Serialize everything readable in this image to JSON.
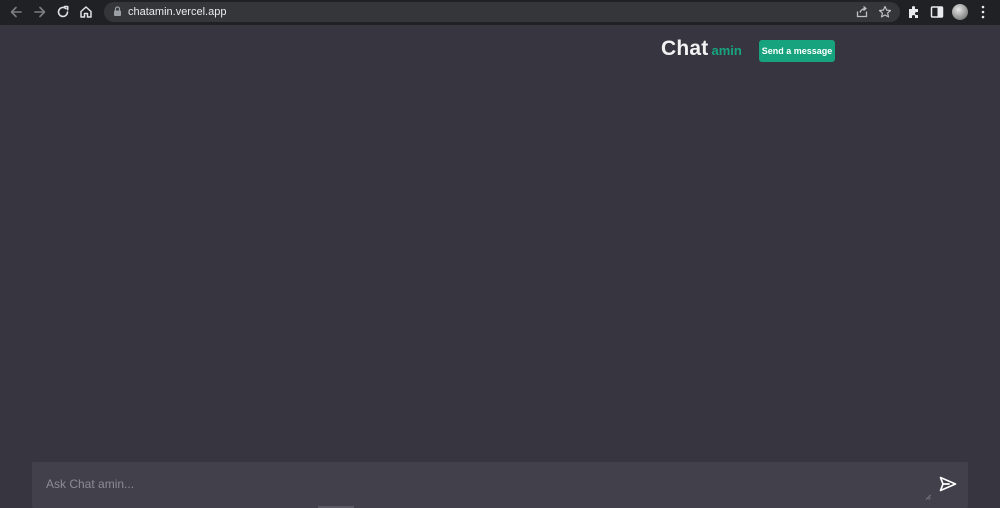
{
  "browser": {
    "url": "chatamin.vercel.app",
    "icons": {
      "back": "arrow-left-icon",
      "forward": "arrow-right-icon",
      "reload": "reload-icon",
      "home": "home-icon",
      "lock": "lock-icon",
      "share": "share-icon",
      "bookmark": "star-icon",
      "extensions": "puzzle-icon",
      "side_panel": "side-panel-icon",
      "profile": "avatar",
      "menu": "kebab-menu-icon"
    }
  },
  "header": {
    "brand_main": "Chat",
    "brand_accent": "amin",
    "send_button_label": "Send a message"
  },
  "composer": {
    "placeholder": "Ask Chat amin...",
    "value": "",
    "send_icon": "send-icon"
  },
  "colors": {
    "background": "#363540",
    "accent": "#16a37d",
    "composer_bg": "#41404b",
    "chrome_bg": "#202124"
  }
}
